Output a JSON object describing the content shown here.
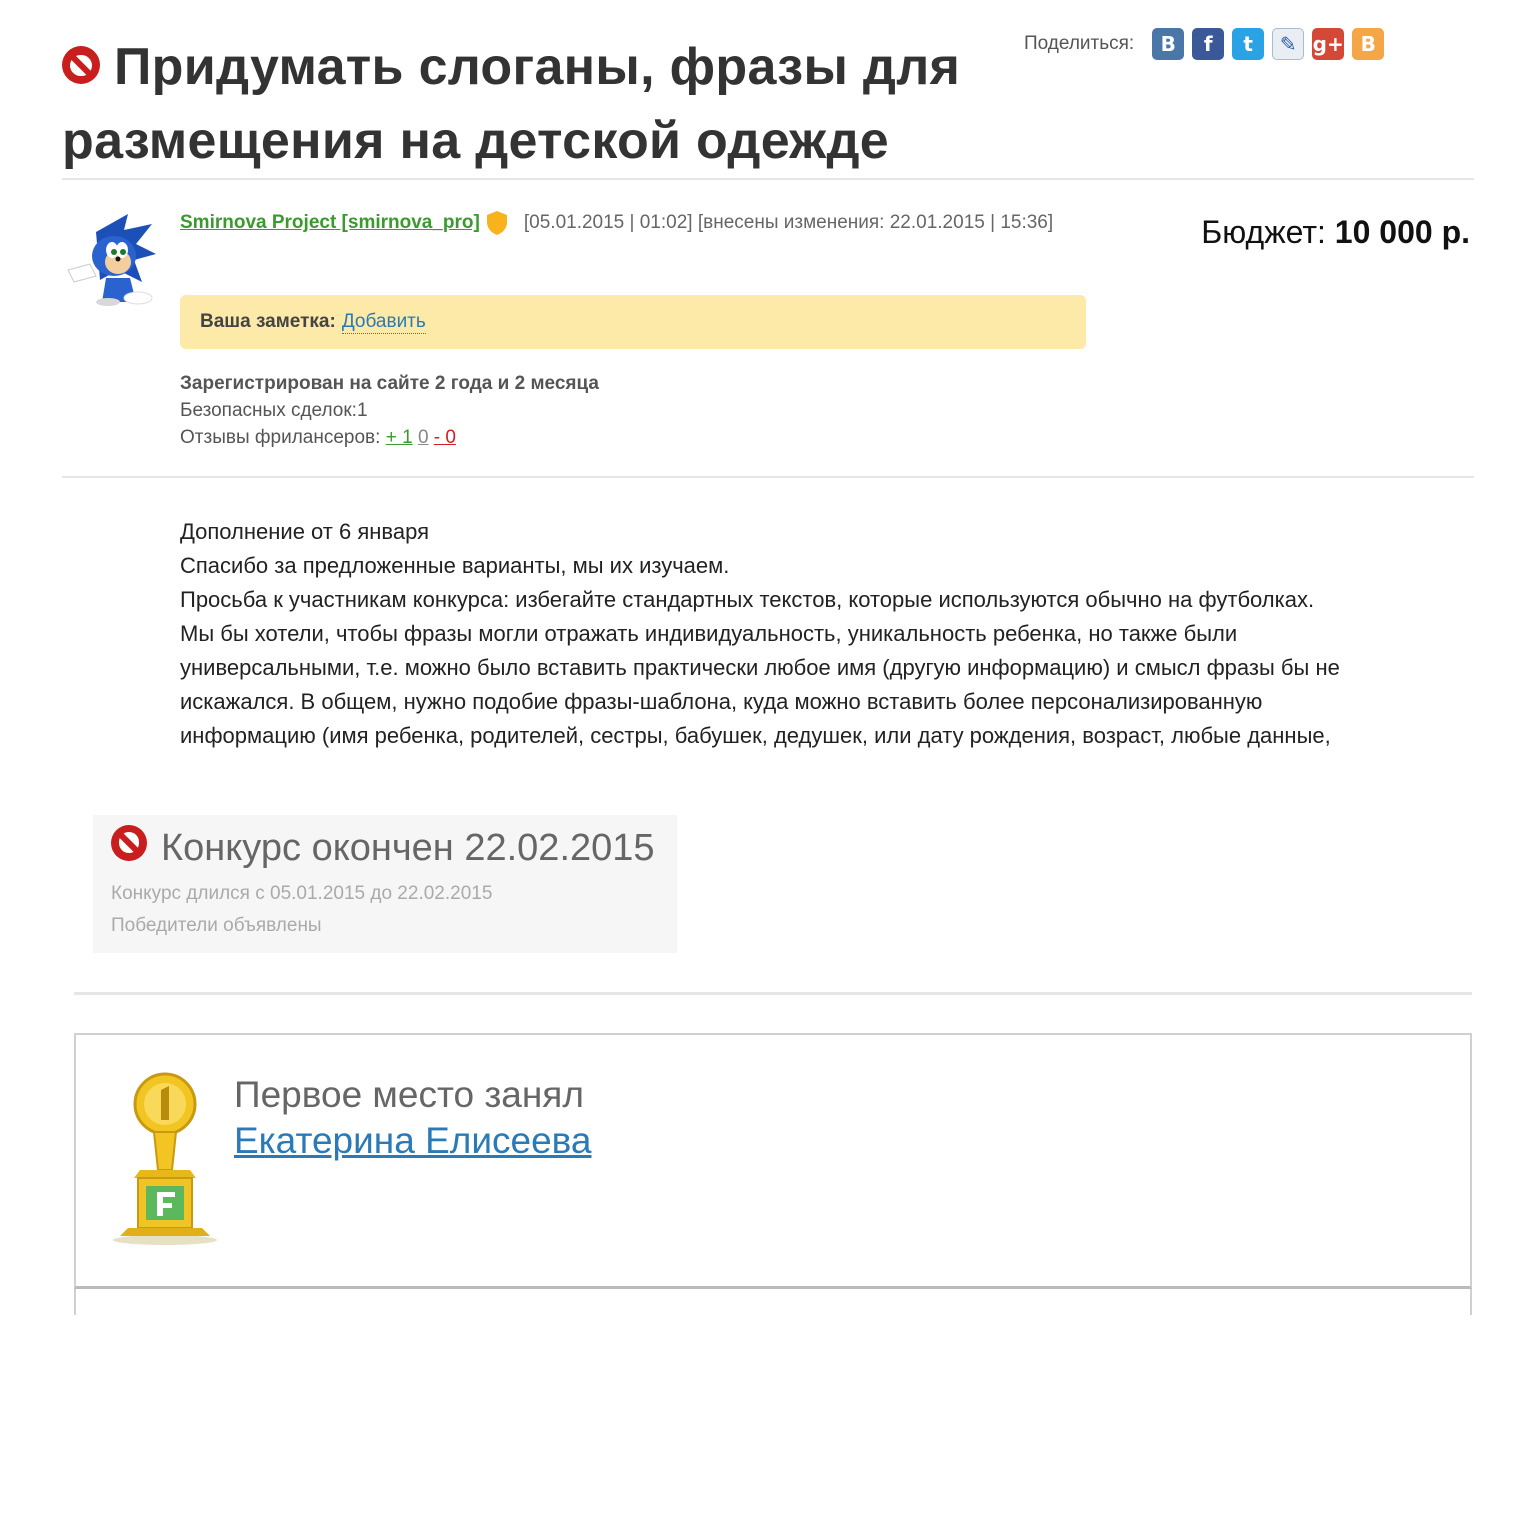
{
  "title": "Придумать слоганы, фразы для размещения на детской одежде",
  "share": {
    "label": "Поделиться:",
    "buttons": [
      {
        "name": "vkontakte-icon",
        "glyph": "B"
      },
      {
        "name": "facebook-icon",
        "glyph": "f"
      },
      {
        "name": "twitter-icon",
        "glyph": "t"
      },
      {
        "name": "livejournal-icon",
        "glyph": "✎"
      },
      {
        "name": "google-plus-icon",
        "glyph": "g+"
      },
      {
        "name": "blogger-icon",
        "glyph": "B"
      }
    ]
  },
  "author": {
    "link": "Smirnova Project [smirnova_pro]",
    "dates": "[05.01.2015 | 01:02] [внесены изменения: 22.01.2015 | 15:36]"
  },
  "budget": {
    "label": "Бюджет:",
    "value": "10 000 р."
  },
  "note": {
    "label": "Ваша заметка:",
    "link": "Добавить"
  },
  "registration": {
    "registered": "Зарегистрирован на сайте 2 года и 2 месяца",
    "deals": "Безопасных сделок:1",
    "reviews_label": "Отзывы фрилансеров:",
    "reviews_positive": "+ 1",
    "reviews_neutral": "0",
    "reviews_negative": "- 0"
  },
  "description": {
    "lines": [
      "Дополнение от 6 января",
      "Спасибо за предложенные варианты, мы их изучаем.",
      "Просьба к участникам конкурса: избегайте стандартных текстов, которые используются обычно на футболках.",
      "Мы бы хотели, чтобы фразы могли отражать индивидуальность, уникальность ребенка, но также были",
      "универсальными, т.е. можно было вставить практически любое имя (другую информацию) и смысл фразы бы не",
      "искажался. В общем, нужно подобие фразы-шаблона, куда можно вставить более персонализированную",
      "информацию (имя ребенка, родителей, сестры, бабушек, дедушек, или дату рождения, возраст, любые данные,"
    ]
  },
  "contest": {
    "title": "Конкурс окончен 22.02.2015",
    "duration": "Конкурс длился с 05.01.2015 до 22.02.2015",
    "winners": "Победители объявлены"
  },
  "winner": {
    "label": "Первое место занял",
    "name": "Екатерина Елисеева"
  },
  "colors": {
    "accent_link": "#2a7ab8",
    "author_green": "#3a9a2e",
    "stop_red": "#c81e1e",
    "note_bg": "#fde9a8"
  }
}
